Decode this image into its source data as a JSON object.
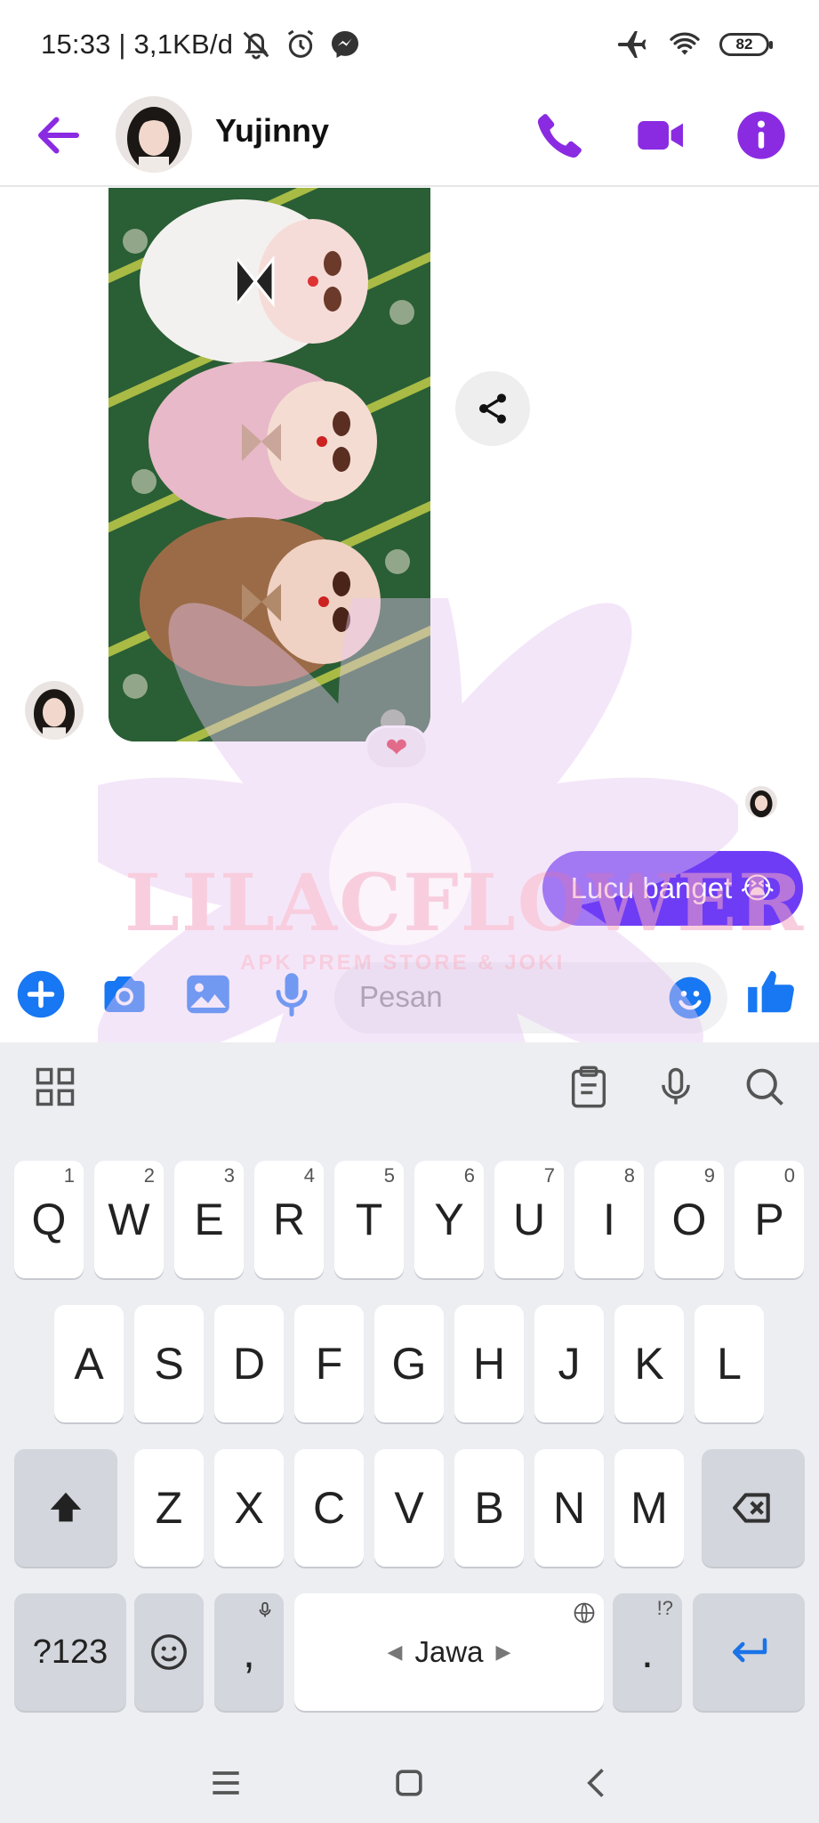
{
  "status": {
    "time_speed": "15:33 | 3,1KB/d",
    "battery": "82",
    "icons": [
      "mute-icon",
      "alarm-icon",
      "messenger-icon",
      "airplane-icon",
      "wifi-icon",
      "battery-icon"
    ]
  },
  "header": {
    "name": "Yujinny",
    "accent": "#8a2be2",
    "actions": [
      "phone-icon",
      "video-icon",
      "info-icon"
    ]
  },
  "chat": {
    "reaction": "❤",
    "outgoing_message": "Lucu banget 😭",
    "bubble_color": "#6e3cf5"
  },
  "watermark": {
    "title": "LILACFLOWER",
    "subtitle": "APK PREM STORE & JOKI"
  },
  "composer": {
    "placeholder": "Pesan",
    "accent": "#1877f2"
  },
  "keyboard": {
    "row1": [
      {
        "k": "Q",
        "h": "1"
      },
      {
        "k": "W",
        "h": "2"
      },
      {
        "k": "E",
        "h": "3"
      },
      {
        "k": "R",
        "h": "4"
      },
      {
        "k": "T",
        "h": "5"
      },
      {
        "k": "Y",
        "h": "6"
      },
      {
        "k": "U",
        "h": "7"
      },
      {
        "k": "I",
        "h": "8"
      },
      {
        "k": "O",
        "h": "9"
      },
      {
        "k": "P",
        "h": "0"
      }
    ],
    "row2": [
      "A",
      "S",
      "D",
      "F",
      "G",
      "H",
      "J",
      "K",
      "L"
    ],
    "row3": [
      "Z",
      "X",
      "C",
      "V",
      "B",
      "N",
      "M"
    ],
    "symbols_label": "?123",
    "comma": ",",
    "period": ".",
    "period_hint": "!?",
    "space_label": "Jawa"
  }
}
